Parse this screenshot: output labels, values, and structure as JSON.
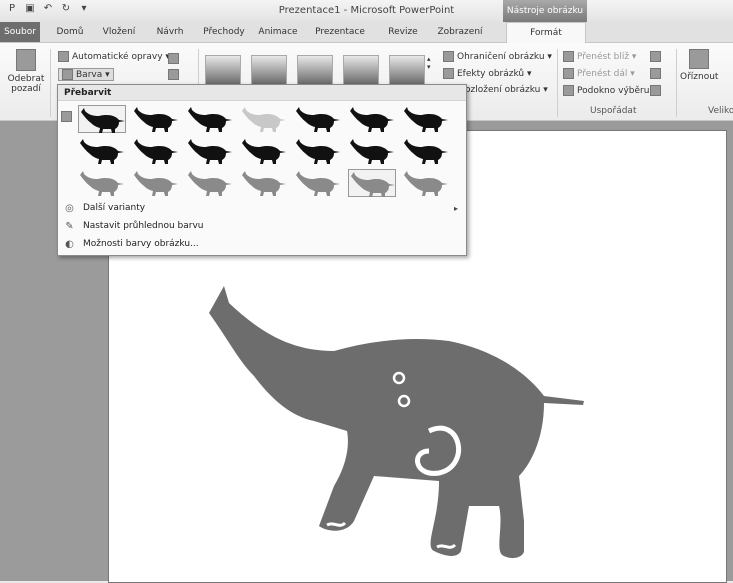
{
  "window": {
    "title": "Prezentace1 - Microsoft PowerPoint",
    "context_header": "Nástroje obrázku"
  },
  "tabs": [
    "Soubor",
    "Domů",
    "Vložení",
    "Návrh",
    "Přechody",
    "Animace",
    "Prezentace",
    "Revize",
    "Zobrazení",
    "Formát"
  ],
  "ribbon": {
    "remove_bg": "Odebrat pozadí",
    "auto_corrections": "Automatické opravy ▾",
    "color": "Barva ▾",
    "border": "Ohraničení obrázku ▾",
    "effects": "Efekty obrázků ▾",
    "layout": "ozložení obrázku ▾",
    "bring_forward": "Přenést blíž ▾",
    "send_backward": "Přenést dál ▾",
    "selection_pane": "Podokno výběru",
    "arrange_label": "Uspořádat",
    "crop": "Oříznout",
    "size_label": "Veliko"
  },
  "dropdown": {
    "header": "Přebarvit",
    "more_variants": "Další varianty",
    "set_transparent": "Nastavit průhlednou barvu",
    "color_options": "Možnosti barvy obrázku..."
  },
  "colors": {
    "dark": "#111111",
    "light": "#c8c8c8",
    "mid": "#8a8a8a",
    "slide_elephant": "#6d6d6d"
  }
}
